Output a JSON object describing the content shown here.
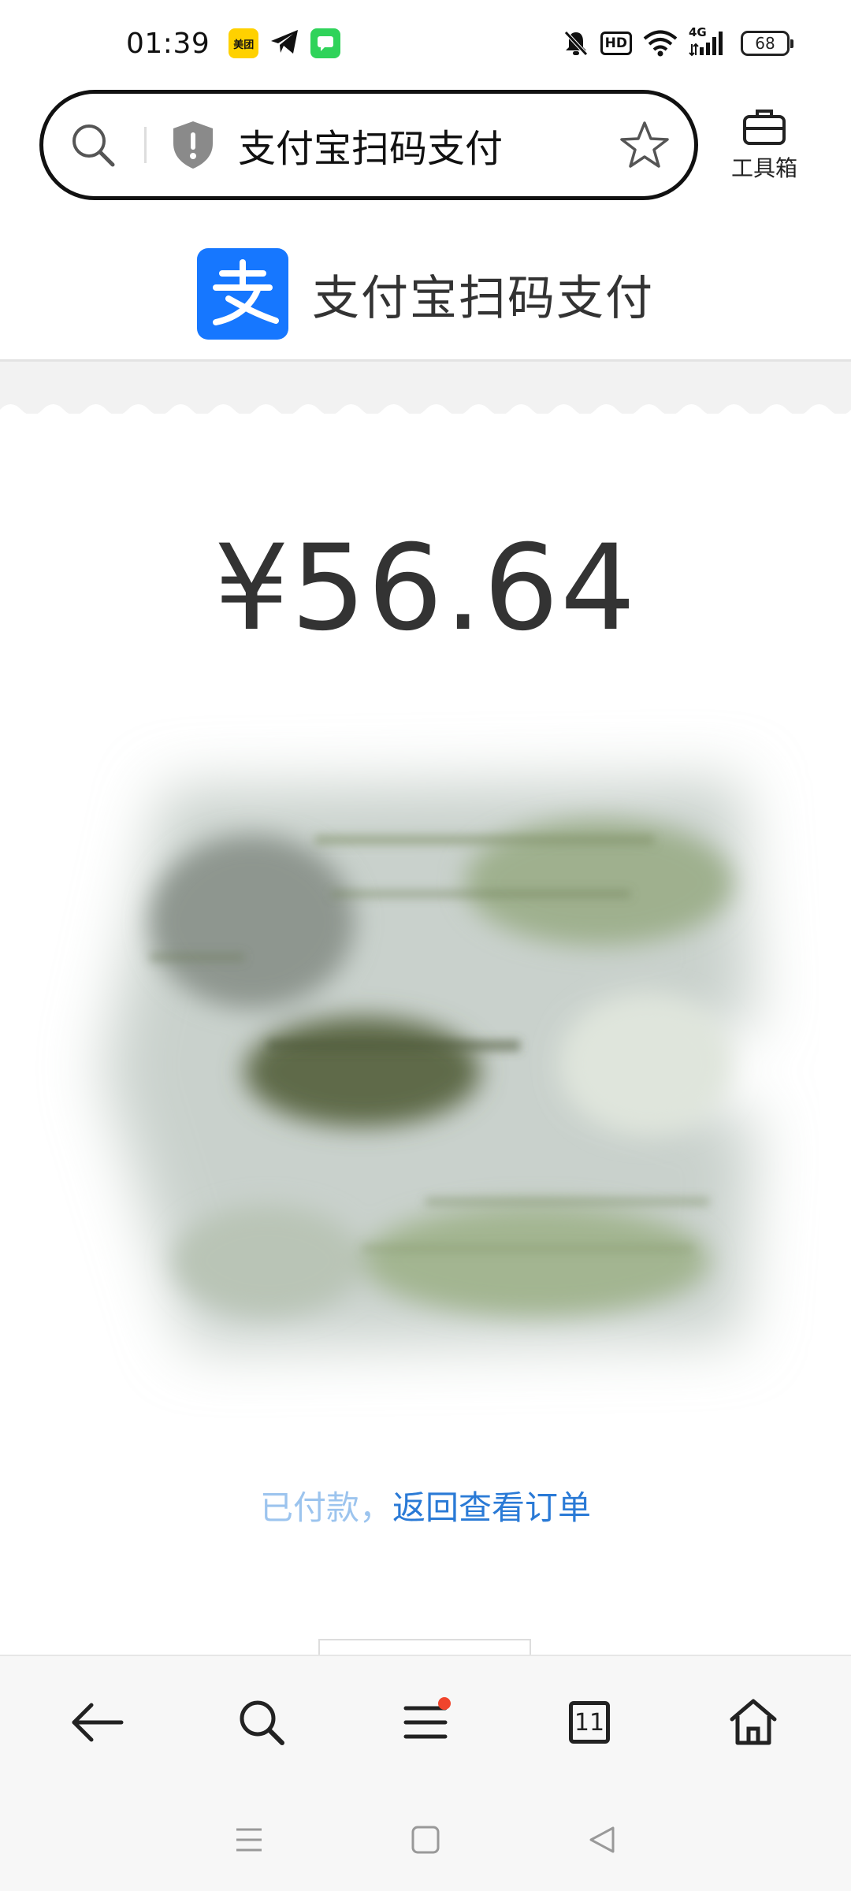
{
  "status_bar": {
    "time": "01:39",
    "meituan_badge": "美团",
    "hd_label": "HD",
    "network_label": "4G",
    "battery_level": "68"
  },
  "address_bar": {
    "text": "支付宝扫码支付"
  },
  "toolbox": {
    "label": "工具箱"
  },
  "header": {
    "logo_glyph": "支",
    "title": "支付宝扫码支付"
  },
  "payment": {
    "amount": "¥56.64"
  },
  "hint": {
    "faded_text": "已付款，",
    "link_text": "返回查看订单"
  },
  "bottom_nav": {
    "tab_count": "11"
  },
  "colors": {
    "alipay_blue": "#1677ff",
    "link_blue": "#2a7ad6",
    "notification_red": "#f0442c",
    "badge_yellow": "#ffd100",
    "badge_green": "#2fd35a"
  },
  "icons": {
    "search": "search-icon",
    "shield": "shield-warning-icon",
    "star": "star-icon",
    "toolbox": "toolbox-icon",
    "back": "back-arrow-icon",
    "menu": "menu-icon",
    "home": "home-icon"
  }
}
